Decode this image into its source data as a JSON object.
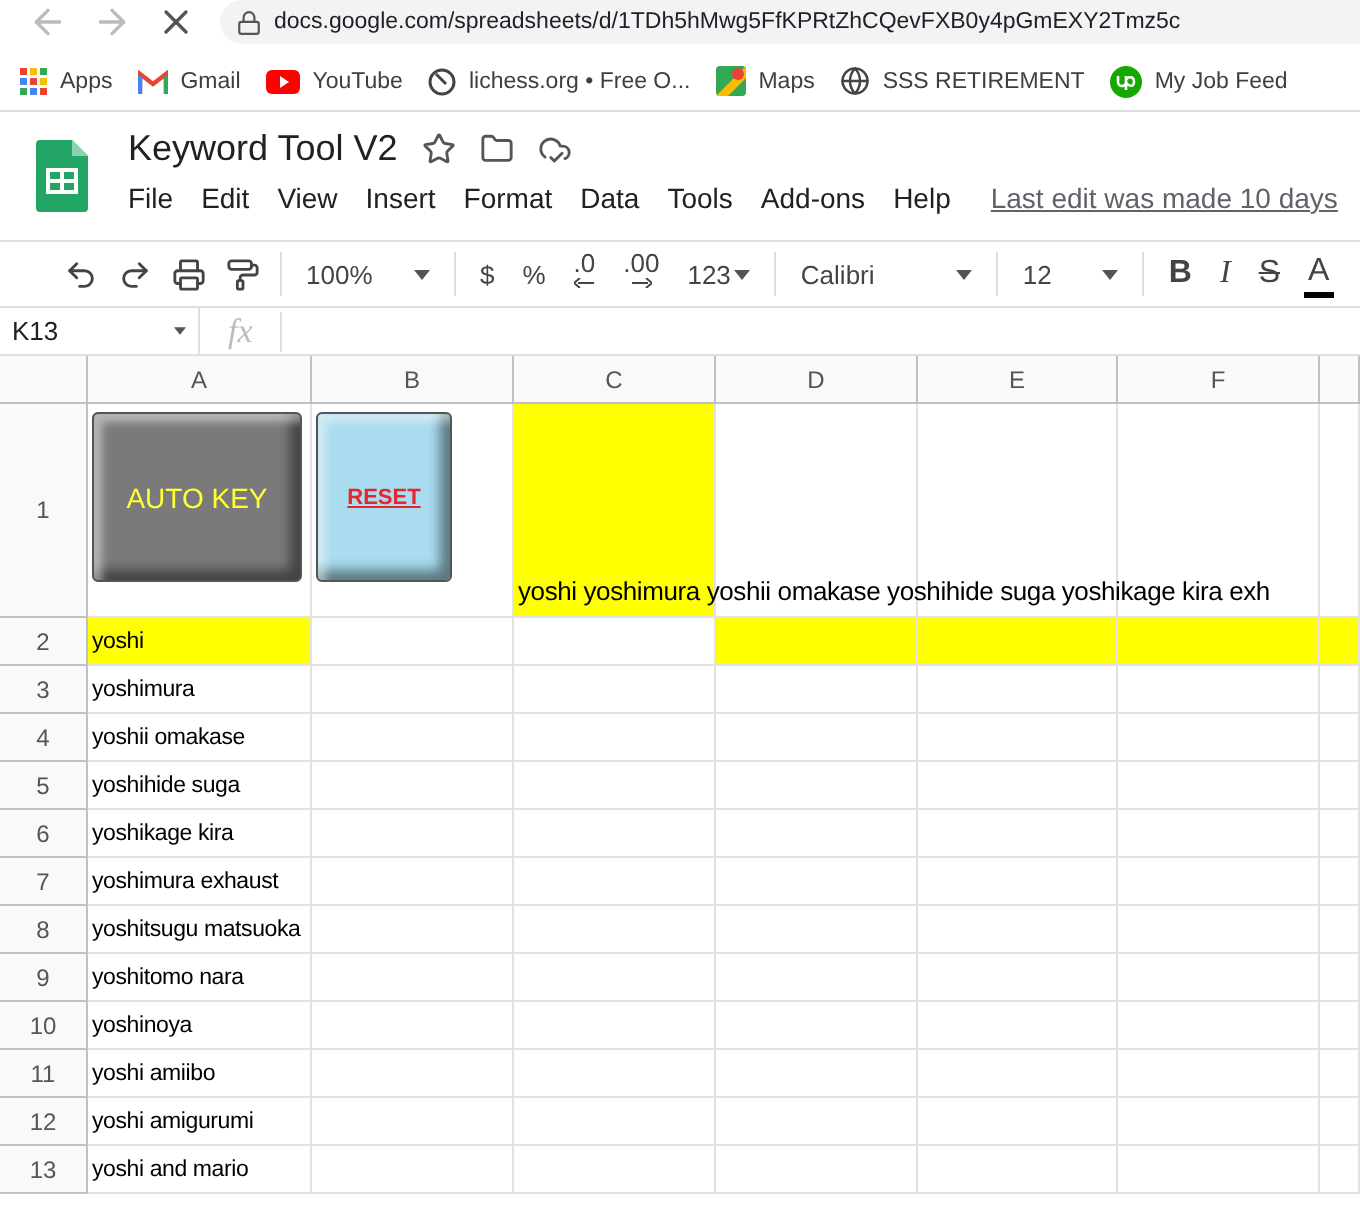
{
  "browser": {
    "url": "docs.google.com/spreadsheets/d/1TDh5hMwg5FfKPRtZhCQevFXB0y4pGmEXY2Tmz5c"
  },
  "bookmarks": [
    {
      "label": "Apps",
      "kind": "apps"
    },
    {
      "label": "Gmail",
      "kind": "gmail"
    },
    {
      "label": "YouTube",
      "kind": "youtube"
    },
    {
      "label": "lichess.org • Free O...",
      "kind": "lichess"
    },
    {
      "label": "Maps",
      "kind": "maps"
    },
    {
      "label": "SSS RETIREMENT",
      "kind": "globe"
    },
    {
      "label": "My Job Feed",
      "kind": "upwork"
    }
  ],
  "document": {
    "title": "Keyword Tool V2",
    "menu": [
      "File",
      "Edit",
      "View",
      "Insert",
      "Format",
      "Data",
      "Tools",
      "Add-ons",
      "Help"
    ],
    "last_edit": "Last edit was made 10 days"
  },
  "toolbar": {
    "zoom": "100%",
    "currency": "$",
    "percent": "%",
    "decrease_decimal": ".0",
    "increase_decimal": ".00",
    "more_formats": "123",
    "font": "Calibri",
    "font_size": "12",
    "bold": "B",
    "italic": "I",
    "strikethrough": "S",
    "text_color": "A"
  },
  "formula_bar": {
    "cell_ref": "K13",
    "fx": "fx"
  },
  "sheet": {
    "columns": [
      "A",
      "B",
      "C",
      "D",
      "E",
      "F"
    ],
    "row_1": {
      "label": "1",
      "buttons": [
        {
          "label": "AUTO KEY",
          "kind": "auto"
        },
        {
          "label": "RESET",
          "kind": "reset"
        }
      ],
      "overflow_text": "yoshi yoshimura yoshii omakase yoshihide suga yoshikage kira exh",
      "highlighted": [
        false,
        false,
        true,
        false,
        false,
        false,
        false
      ]
    },
    "rows": [
      {
        "label": "2",
        "value": "yoshi",
        "highlighted": [
          true,
          false,
          false,
          true,
          true,
          true,
          true
        ]
      },
      {
        "label": "3",
        "value": "yoshimura"
      },
      {
        "label": "4",
        "value": "yoshii omakase"
      },
      {
        "label": "5",
        "value": "yoshihide suga"
      },
      {
        "label": "6",
        "value": "yoshikage kira"
      },
      {
        "label": "7",
        "value": "yoshimura exhaust"
      },
      {
        "label": "8",
        "value": "yoshitsugu matsuoka"
      },
      {
        "label": "9",
        "value": "yoshitomo nara"
      },
      {
        "label": "10",
        "value": "yoshinoya"
      },
      {
        "label": "11",
        "value": "yoshi amiibo"
      },
      {
        "label": "12",
        "value": "yoshi amigurumi"
      },
      {
        "label": "13",
        "value": "yoshi and mario"
      }
    ]
  }
}
